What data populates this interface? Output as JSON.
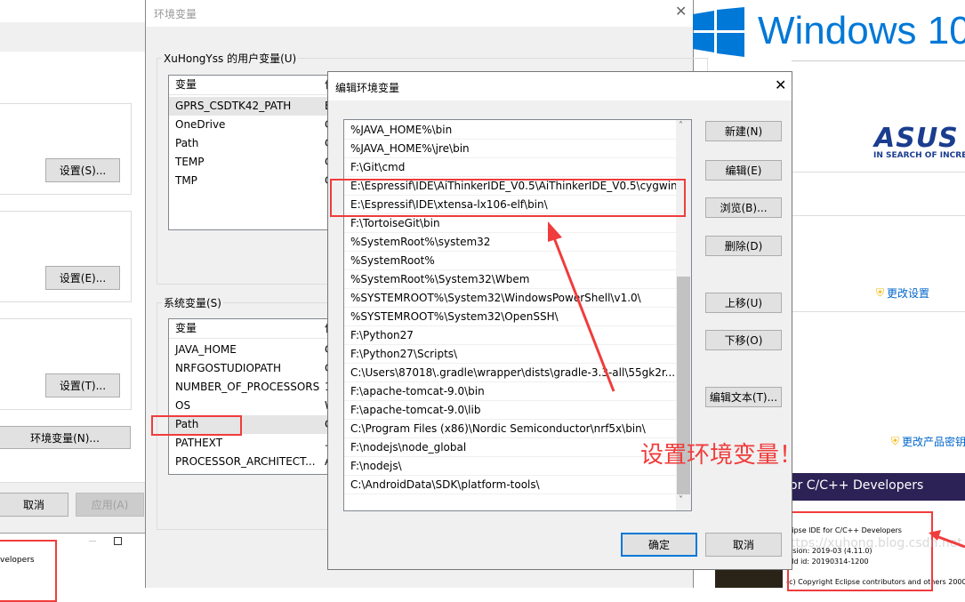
{
  "left_dialog": {
    "set_s": "设置(S)...",
    "set_e": "设置(E)...",
    "set_t": "设置(T)...",
    "env_vars": "环境变量(N)...",
    "cancel": "取消",
    "apply": "应用(A)",
    "eclipse_fragment": "velopers"
  },
  "env_dialog": {
    "title": "环境变量",
    "user_group": "XuHongYss 的用户变量(U)",
    "system_group": "系统变量(S)",
    "col_var": "变量",
    "col_val": "值",
    "user_vars": [
      {
        "name": "GPRS_CSDTK42_PATH",
        "value": "E"
      },
      {
        "name": "OneDrive",
        "value": "C"
      },
      {
        "name": "Path",
        "value": "C"
      },
      {
        "name": "TEMP",
        "value": "C"
      },
      {
        "name": "TMP",
        "value": "C"
      }
    ],
    "system_vars": [
      {
        "name": "JAVA_HOME",
        "value": "C"
      },
      {
        "name": "NRFGOSTUDIOPATH",
        "value": "C"
      },
      {
        "name": "NUMBER_OF_PROCESSORS",
        "value": "1"
      },
      {
        "name": "OS",
        "value": "W"
      },
      {
        "name": "Path",
        "value": "C"
      },
      {
        "name": "PATHEXT",
        "value": "."
      },
      {
        "name": "PROCESSOR_ARCHITECT...",
        "value": "A"
      }
    ]
  },
  "edit_dialog": {
    "title": "编辑环境变量",
    "entries": [
      "%JAVA_HOME%\\bin",
      "%JAVA_HOME%\\jre\\bin",
      "F:\\Git\\cmd",
      "E:\\Espressif\\IDE\\AiThinkerIDE_V0.5\\AiThinkerIDE_V0.5\\cygwin...",
      "E:\\Espressif\\IDE\\xtensa-lx106-elf\\bin\\",
      "F:\\TortoiseGit\\bin",
      "%SystemRoot%\\system32",
      "%SystemRoot%",
      "%SystemRoot%\\System32\\Wbem",
      "%SYSTEMROOT%\\System32\\WindowsPowerShell\\v1.0\\",
      "%SYSTEMROOT%\\System32\\OpenSSH\\",
      "F:\\Python27",
      "F:\\Python27\\Scripts\\",
      "C:\\Users\\87018\\.gradle\\wrapper\\dists\\gradle-3.3-all\\55gk2r...",
      "F:\\apache-tomcat-9.0\\bin",
      "F:\\apache-tomcat-9.0\\lib",
      "C:\\Program Files (x86)\\Nordic Semiconductor\\nrf5x\\bin\\",
      "F:\\nodejs\\node_global",
      "F:\\nodejs\\",
      "C:\\AndroidData\\SDK\\platform-tools\\"
    ],
    "buttons": {
      "new": "新建(N)",
      "edit": "编辑(E)",
      "browse": "浏览(B)...",
      "delete": "删除(D)",
      "up": "上移(U)",
      "down": "下移(O)",
      "edit_text": "编辑文本(T)..."
    },
    "ok": "确定",
    "cancel": "取消"
  },
  "annotation": "设置环境变量！",
  "background": {
    "windows_brand": "Windows 10",
    "asus_logo": "ASUS",
    "asus_tagline": "IN SEARCH OF INCREDIBLE",
    "change_settings": "更改设置",
    "change_key": "更改产品密钥",
    "eclipse_banner": "or C/C++ Developers",
    "eclipse_name": "lipse IDE for C/C++ Developers",
    "eclipse_version": "rsion: 2019-03 (4.11.0)",
    "eclipse_build": "ild id: 20190314-1200",
    "eclipse_copyright": "(c) Copyright Eclipse contributors and others 2000,",
    "watermark": "https://xuhong.blog.csdn.net"
  },
  "colors": {
    "accent": "#0078d7",
    "annotation_red": "#f03c3c",
    "eclipse_purple": "#2c2255"
  }
}
